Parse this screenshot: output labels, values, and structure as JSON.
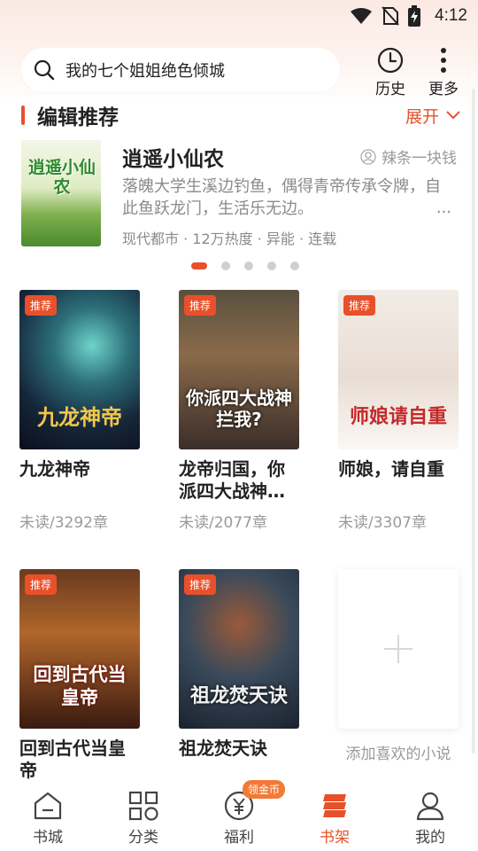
{
  "status_bar": {
    "time": "4:12"
  },
  "search": {
    "placeholder_text": "我的七个姐姐绝色倾城"
  },
  "top_actions": {
    "history_label": "历史",
    "more_label": "更多"
  },
  "editor_section": {
    "title": "编辑推荐",
    "expand_label": "展开",
    "featured": {
      "cover_title": "逍遥小仙农",
      "title": "逍遥小仙农",
      "author": "辣条一块钱",
      "description": "落魄大学生溪边钓鱼，偶得青帝传承令牌，自此鱼跃龙门，生活乐无边。",
      "ellipsis": "...",
      "meta": "现代都市 · 12万热度 · 异能 · 连载"
    },
    "carousel_pages": 5,
    "carousel_active_index": 0
  },
  "books": [
    {
      "tag": "推荐",
      "cover_text": "九龙神帝",
      "title": "九龙神帝",
      "progress": "未读/3292章"
    },
    {
      "tag": "推荐",
      "cover_text": "你派四大战神拦我?",
      "title": "龙帝归国，你派四大战神…",
      "progress": "未读/2077章"
    },
    {
      "tag": "推荐",
      "cover_text": "师娘请自重",
      "title": "师娘，请自重",
      "progress": "未读/3307章"
    },
    {
      "tag": "推荐",
      "cover_text": "回到古代当皇帝",
      "title": "回到古代当皇帝",
      "progress": ""
    },
    {
      "tag": "推荐",
      "cover_text": "祖龙焚天诀",
      "title": "祖龙焚天诀",
      "progress": ""
    }
  ],
  "add_card": {
    "label": "添加喜欢的小说"
  },
  "bottom_nav": {
    "items": [
      {
        "label": "书城",
        "icon": "home-icon"
      },
      {
        "label": "分类",
        "icon": "category-grid-icon"
      },
      {
        "label": "福利",
        "icon": "coin-icon",
        "badge": "领金币"
      },
      {
        "label": "书架",
        "icon": "bookshelf-icon",
        "active": true
      },
      {
        "label": "我的",
        "icon": "profile-icon"
      }
    ]
  },
  "colors": {
    "accent": "#e8502a",
    "badge": "#f27a36",
    "muted_text": "#9a9a9a"
  }
}
